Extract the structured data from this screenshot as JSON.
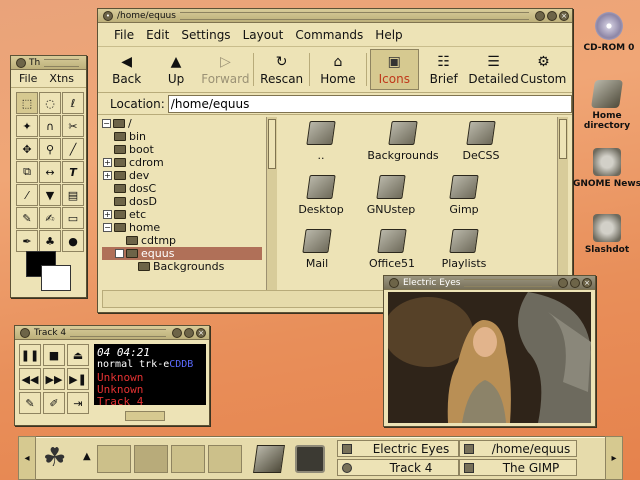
{
  "file_manager": {
    "title": "/home/equus",
    "menu": [
      "File",
      "Edit",
      "Settings",
      "Layout",
      "Commands",
      "Help"
    ],
    "toolbar": [
      "Back",
      "Up",
      "Forward",
      "Rescan",
      "Home",
      "Icons",
      "Brief",
      "Detailed",
      "Custom"
    ],
    "location_label": "Location:",
    "location_value": "/home/equus",
    "tree": [
      "/",
      "bin",
      "boot",
      "cdrom",
      "dev",
      "dosC",
      "dosD",
      "etc",
      "home",
      "cdtmp",
      "equus",
      "Backgrounds"
    ],
    "icons": [
      "..",
      "Backgrounds",
      "DeCSS",
      "Desktop",
      "GNUstep",
      "Gimp",
      "Mail",
      "Office51",
      "Playlists"
    ]
  },
  "toolbox": {
    "title": "Th",
    "menu": [
      "File",
      "Xtns"
    ]
  },
  "cd_player": {
    "title": "Track 4",
    "lcd_line1": "04   04:21",
    "lcd_line2_a": "normal trk-e",
    "lcd_line2_b": "CDDB",
    "artist": "Unknown",
    "album": "Unknown",
    "track": "Track 4"
  },
  "image_viewer": {
    "title": "Electric Eyes"
  },
  "desktop_icons": [
    "CD-ROM 0",
    "Home directory",
    "GNOME News",
    "Slashdot"
  ],
  "panel": {
    "tasks": [
      "Electric Eyes",
      "/home/equus",
      "Track 4",
      "The GIMP"
    ]
  }
}
